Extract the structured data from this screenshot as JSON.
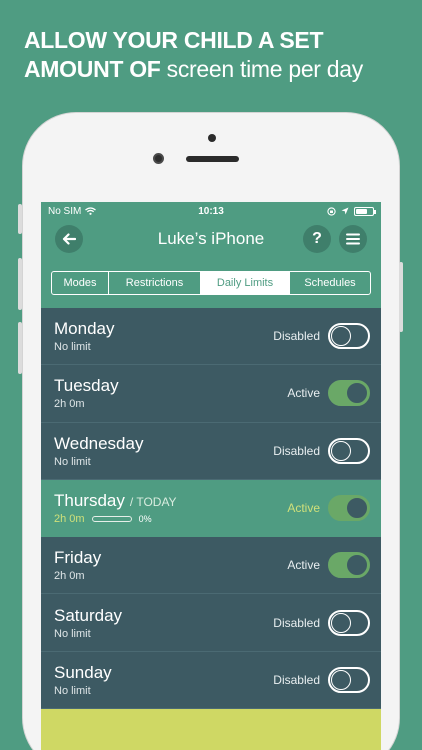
{
  "headline": {
    "bold": "ALLOW YOUR CHILD A SET AMOUNT OF",
    "light": "screen time per day"
  },
  "status": {
    "carrier": "No SIM",
    "time": "10:13",
    "battery_level": 0.7
  },
  "nav": {
    "title": "Luke’s iPhone",
    "back_icon": "back-arrow-icon",
    "help_label": "?",
    "menu_icon": "hamburger-menu-icon"
  },
  "tabs": [
    "Modes",
    "Restrictions",
    "Daily Limits",
    "Schedules"
  ],
  "active_tab": "Daily Limits",
  "days": [
    {
      "day": "Monday",
      "limit": "No limit",
      "state": "Disabled",
      "on": false
    },
    {
      "day": "Tuesday",
      "limit": "2h 0m",
      "state": "Active",
      "on": true
    },
    {
      "day": "Wednesday",
      "limit": "No limit",
      "state": "Disabled",
      "on": false
    },
    {
      "day": "Thursday",
      "today_tag": "/ TODAY",
      "limit": "2h 0m",
      "progress_percent": "0%",
      "progress_value": 0,
      "state": "Active",
      "on": true
    },
    {
      "day": "Friday",
      "limit": "2h 0m",
      "state": "Active",
      "on": true
    },
    {
      "day": "Saturday",
      "limit": "No limit",
      "state": "Disabled",
      "on": false
    },
    {
      "day": "Sunday",
      "limit": "No limit",
      "state": "Disabled",
      "on": false
    }
  ],
  "colors": {
    "brand_green": "#4f9c82",
    "row_slate": "#3d5a63",
    "accent_lime": "#cfd864",
    "toggle_on": "#6aa867"
  }
}
